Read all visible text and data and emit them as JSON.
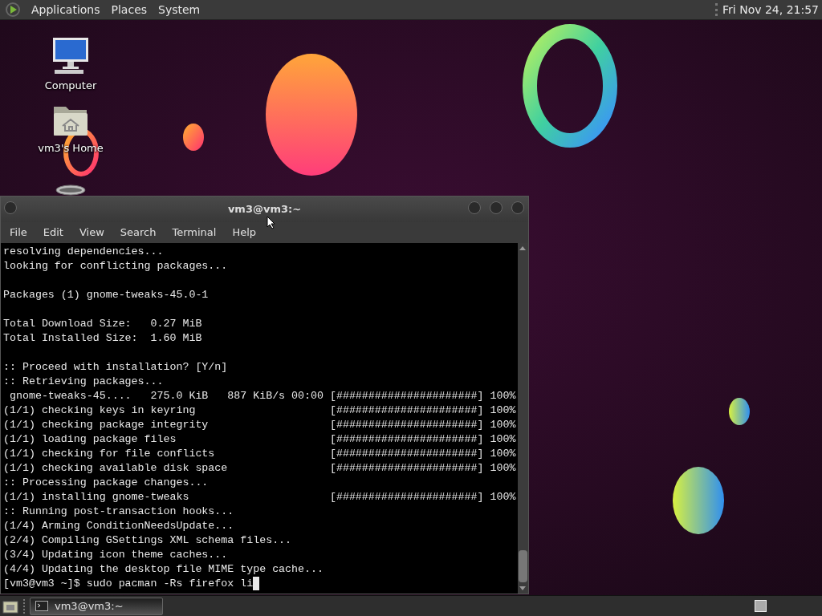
{
  "top_panel": {
    "menus": [
      "Applications",
      "Places",
      "System"
    ],
    "clock": "Fri Nov 24, 21:57"
  },
  "desktop_icons": [
    {
      "kind": "computer",
      "label": "Computer"
    },
    {
      "kind": "home",
      "label": "vm3's Home"
    },
    {
      "kind": "trash"
    }
  ],
  "terminal": {
    "title": "vm3@vm3:~",
    "menus": [
      "File",
      "Edit",
      "View",
      "Search",
      "Terminal",
      "Help"
    ],
    "blocks": [
      [
        "resolving dependencies...",
        "looking for conflicting packages..."
      ],
      [
        "Packages (1) gnome-tweaks-45.0-1"
      ],
      [
        "Total Download Size:   0.27 MiB",
        "Total Installed Size:  1.60 MiB"
      ],
      [
        ":: Proceed with installation? [Y/n]",
        ":: Retrieving packages...",
        " gnome-tweaks-45....   275.0 KiB   887 KiB/s 00:00 [######################] 100%",
        "(1/1) checking keys in keyring                     [######################] 100%",
        "(1/1) checking package integrity                   [######################] 100%",
        "(1/1) loading package files                        [######################] 100%",
        "(1/1) checking for file conflicts                  [######################] 100%",
        "(1/1) checking available disk space                [######################] 100%",
        ":: Processing package changes...",
        "(1/1) installing gnome-tweaks                      [######################] 100%",
        ":: Running post-transaction hooks...",
        "(1/4) Arming ConditionNeedsUpdate...",
        "(2/4) Compiling GSettings XML schema files...",
        "(3/4) Updating icon theme caches...",
        "(4/4) Updating the desktop file MIME type cache..."
      ]
    ],
    "prompt": "[vm3@vm3 ~]$ sudo pacman -Rs firefox li"
  },
  "taskbar": {
    "tasks": [
      {
        "label": "vm3@vm3:~",
        "selected": true
      }
    ]
  }
}
